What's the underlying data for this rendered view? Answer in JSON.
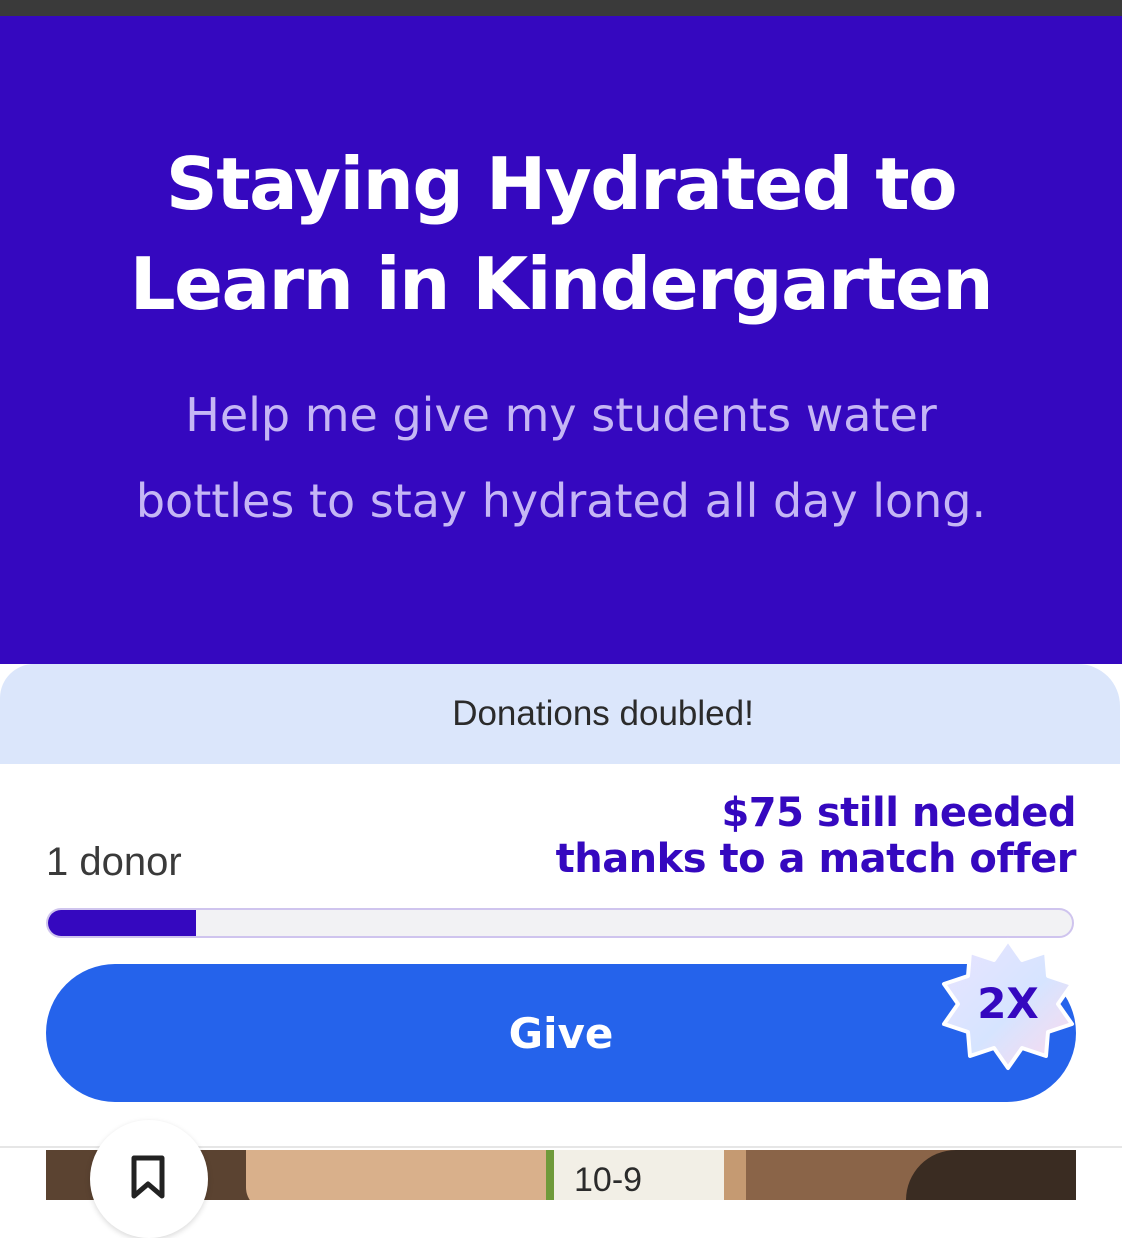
{
  "project": {
    "title": "Staying Hydrated to\nLearn in Kindergarten",
    "subtitle": "Help me give my students water\nbottles to stay hydrated all day long."
  },
  "donation_card": {
    "match_banner": "Donations doubled!",
    "donor_count": "1 donor",
    "still_needed_line1": "$75 still needed",
    "still_needed_line2": "thanks to a match offer",
    "progress_fraction": 0.145,
    "give_button_label": "Give",
    "match_badge": "2X"
  },
  "photo": {
    "poster_text": "10-9"
  },
  "colors": {
    "hero_background": "#3508bf",
    "accent_purple": "#3508bf",
    "give_button_blue": "#2563eb",
    "match_banner_bg": "#dbe6fb"
  },
  "icons": {
    "bookmark": "bookmark-icon",
    "match_badge_shape": "starburst-badge"
  }
}
